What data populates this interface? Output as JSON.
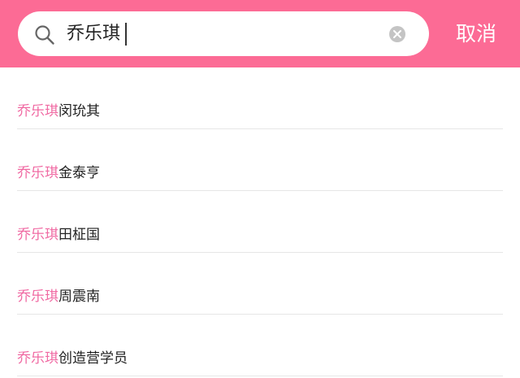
{
  "search": {
    "query": "乔乐琪",
    "cancel_label": "取消"
  },
  "colors": {
    "header_bg": "#fc6b95",
    "highlight": "#f06aa3",
    "divider": "#e6e6e6"
  },
  "icons": {
    "search": "search-icon",
    "clear": "clear-icon"
  },
  "results": [
    {
      "match": "乔乐琪",
      "rest": "闵玧其"
    },
    {
      "match": "乔乐琪",
      "rest": "金泰亨"
    },
    {
      "match": "乔乐琪",
      "rest": "田柾国"
    },
    {
      "match": "乔乐琪",
      "rest": "周震南"
    },
    {
      "match": "乔乐琪",
      "rest": "创造营学员"
    }
  ]
}
